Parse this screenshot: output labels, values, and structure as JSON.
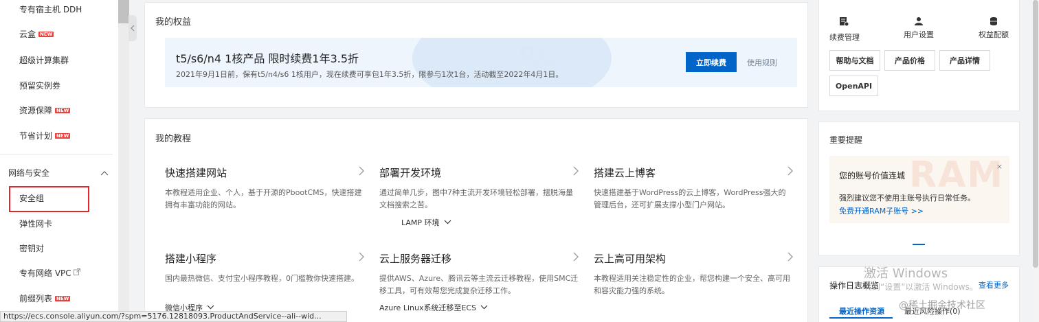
{
  "sidebar": {
    "items_top": [
      {
        "label": "专有宿主机 DDH",
        "new": false
      },
      {
        "label": "云盒",
        "new": true
      },
      {
        "label": "超级计算集群",
        "new": false
      },
      {
        "label": "预留实例券",
        "new": false
      },
      {
        "label": "资源保障",
        "new": true
      },
      {
        "label": "节省计划",
        "new": true
      }
    ],
    "group_label": "网络与安全",
    "items_network": [
      {
        "label": "安全组",
        "new": false,
        "highlighted": true
      },
      {
        "label": "弹性网卡",
        "new": false
      },
      {
        "label": "密钥对",
        "new": false
      },
      {
        "label": "专有网络 VPC",
        "new": false,
        "external": true
      },
      {
        "label": "前缀列表",
        "new": true
      }
    ],
    "new_badge": "NEW"
  },
  "benefits": {
    "title": "我的权益",
    "promo_title": "t5/s6/n4 1核产品 限时续费1年3.5折",
    "promo_desc": "2021年9月1日前，保有t5/n4/s6 1核用户，现在续费可享包1年3.5折，限参与1次1台，活动截至2022年4月1日。",
    "promo_bg_text": "%",
    "renew_button": "立即续费",
    "rules_link": "使用规则"
  },
  "tutorials": {
    "title": "我的教程",
    "items": [
      {
        "title": "快速搭建网站",
        "desc": "本教程适用企业、个人，基于开源的PbootCMS，快速搭建拥有丰富功能的网站。"
      },
      {
        "title": "部署开发环境",
        "desc": "通过简单几步，图中7种主流开发环境轻松部署，摆脱海量文档搜索之苦。",
        "sub": "LAMP 环境"
      },
      {
        "title": "搭建云上博客",
        "desc": "快速搭建基于WordPress的云上博客，WordPress强大的管理后台，还可扩展支撑小型门户网站。"
      },
      {
        "title": "搭建小程序",
        "desc": "国内最热微信、支付宝小程序教程，0门槛教你快速搭建。",
        "sub": "微信小程序"
      },
      {
        "title": "云上服务器迁移",
        "desc": "提供AWS、Azure、腾讯云等主流云迁移教程，使用SMC迁移工具，可有效帮您完成复杂迁移工作。",
        "sub": "Azure Linux系统迁移至ECS"
      },
      {
        "title": "云上高可用架构",
        "desc": "本教程适用关注稳定性的企业，帮您构建一个安全、高可用和容灾能力强的系统。"
      }
    ]
  },
  "quick": {
    "items": [
      {
        "label": "续费管理",
        "icon": "renew-icon"
      },
      {
        "label": "用户设置",
        "icon": "user-icon"
      },
      {
        "label": "权益配额",
        "icon": "quota-icon"
      }
    ],
    "buttons": [
      "帮助与文档",
      "产品价格",
      "产品详情",
      "OpenAPI"
    ]
  },
  "notice": {
    "title": "重要提醒",
    "card_title": "您的账号价值连城",
    "card_desc": "强烈建议您不使用主账号执行日常任务。",
    "card_link": "免费开通RAM子账号 >>",
    "bg_text": "RAM",
    "close": "×"
  },
  "oplog": {
    "title": "操作日志概览",
    "more": "查看更多",
    "tabs": [
      "最近操作资源",
      "最近风险操作(0)"
    ]
  },
  "status_url": "https://ecs.console.aliyun.com/?spm=5176.12818093.ProductAndService--ali--wid...",
  "watermark": {
    "line1": "激活 Windows",
    "line2": "转到“设置”以激活 Windows。",
    "juejin": "@稀土掘金技术社区"
  },
  "colors": {
    "primary": "#0064c8",
    "badge": "#e8423f",
    "highlight": "#e4262b"
  }
}
